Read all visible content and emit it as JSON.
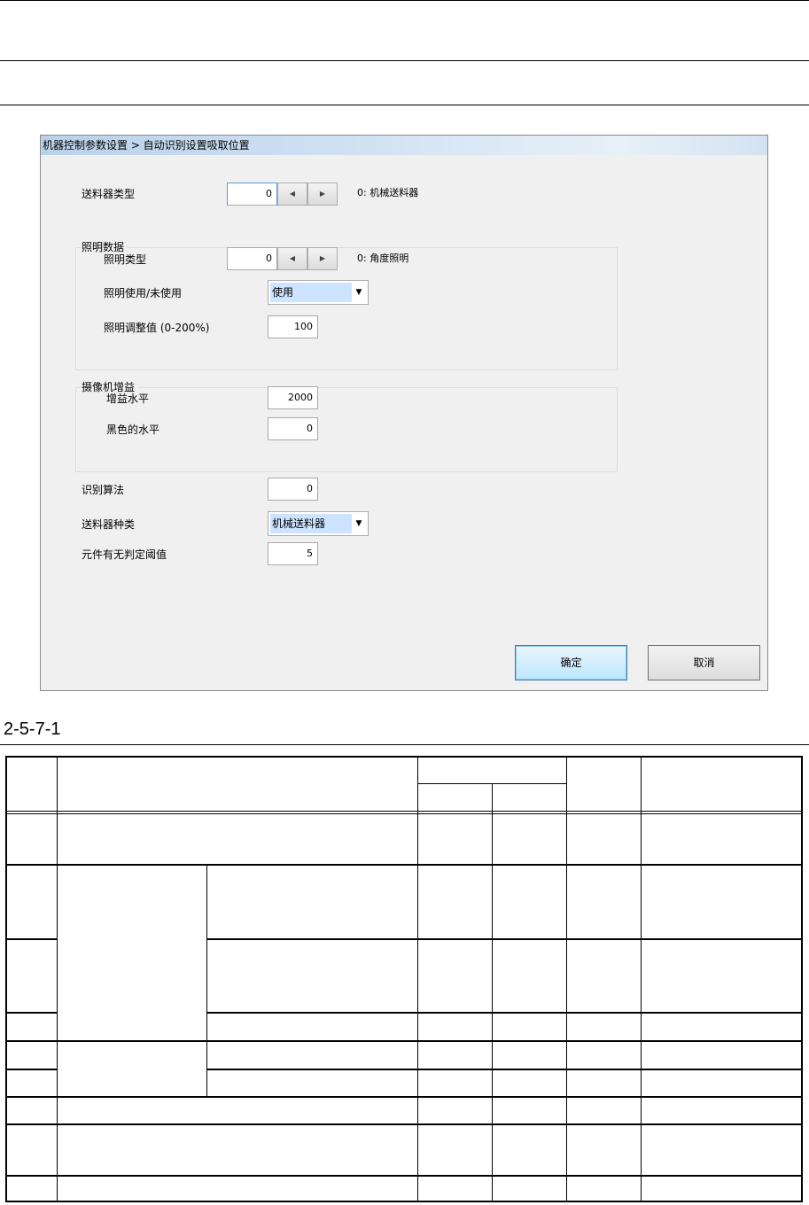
{
  "dialog": {
    "title": "机器控制参数设置 > 自动识别设置吸取位置",
    "feeder_type": {
      "label": "送料器类型",
      "value": "0",
      "desc": "0: 机械送料器"
    },
    "lighting_group": {
      "title": "照明数据",
      "light_type": {
        "label": "照明类型",
        "value": "0",
        "desc": "0: 角度照明"
      },
      "light_use": {
        "label": "照明使用/未使用",
        "selected": "使用"
      },
      "light_adjust": {
        "label": "照明调整值 (0-200%)",
        "value": "100"
      }
    },
    "camera_group": {
      "title": "摄像机增益",
      "gain_level": {
        "label": "增益水平",
        "value": "2000"
      },
      "black_level": {
        "label": "黑色的水平",
        "value": "0"
      }
    },
    "recognition_algorithm": {
      "label": "识别算法",
      "value": "0"
    },
    "feeder_kind": {
      "label": "送料器种类",
      "selected": "机械送料器"
    },
    "presence_threshold": {
      "label": "元件有无判定阈值",
      "value": "5"
    },
    "ok_label": "确定",
    "cancel_label": "取消",
    "spin_left_icon": "◀",
    "spin_right_icon": "▶",
    "dropdown_icon": "▼"
  },
  "caption": "2-5-7-1"
}
